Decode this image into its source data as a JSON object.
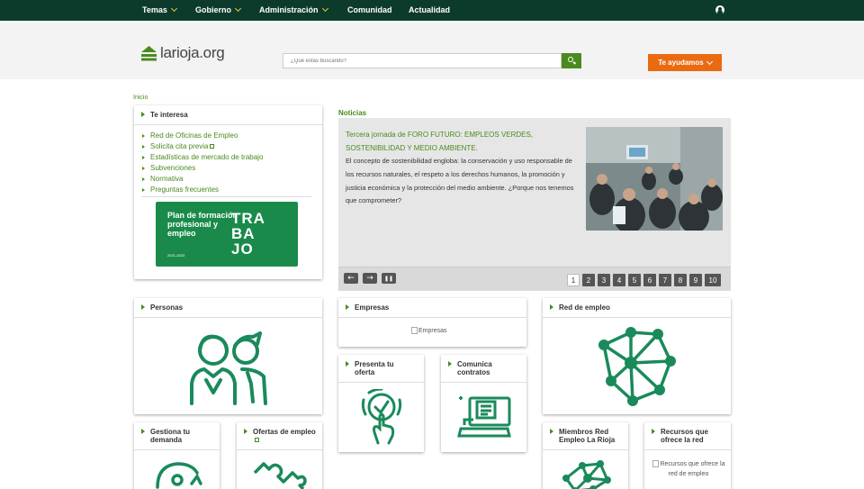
{
  "topnav": {
    "items": [
      {
        "label": "Temas",
        "dropdown": true
      },
      {
        "label": "Gobierno",
        "dropdown": true
      },
      {
        "label": "Administración",
        "dropdown": true
      },
      {
        "label": "Comunidad",
        "dropdown": false
      },
      {
        "label": "Actualidad",
        "dropdown": false
      }
    ]
  },
  "header": {
    "logo_text": "larioja.org",
    "search_placeholder": "¿Qué estás buscando?",
    "help_label": "Te ayudamos"
  },
  "breadcrumb": "Inicio",
  "interesa": {
    "title": "Te interesa",
    "links": [
      "Red de Oficinas de Empleo",
      "Solicita cita previa",
      "Estadísticas de mercado de trabajo",
      "Subvenciones",
      "Normativa",
      "Preguntas frecuentes"
    ],
    "banner_title": "Plan de formación profesional y empleo",
    "banner_years": "2021-2023",
    "banner_big": [
      "TRA",
      "BA",
      "JO"
    ]
  },
  "news": {
    "label": "Noticias",
    "title": "Tercera jornada de FORO FUTURO: EMPLEOS VERDES, SOSTENIBILIDAD Y MEDIO AMBIENTE.",
    "body": "El concepto de sostenibilidad engloba: la conservación y uso responsable de los recursos naturales, el respeto a los derechos humanos, la promoción y justicia económica y la protección del medio ambiente. ¿Porque nos tenemos que comprometer?",
    "pages": [
      "1",
      "2",
      "3",
      "4",
      "5",
      "6",
      "7",
      "8",
      "9",
      "10"
    ],
    "active_page": "1",
    "prev": "←",
    "next": "→",
    "pause": "❚❚"
  },
  "tiles": {
    "personas": "Personas",
    "empresas": "Empresas",
    "empresas_alt": "Empresas",
    "red_empleo": "Red de empleo",
    "presenta": "Presenta tu oferta",
    "comunica": "Comunica contratos",
    "gestiona": "Gestiona tu demanda",
    "ofertas": "Ofertas de empleo",
    "miembros": "Miembros Red Empleo La Rioja",
    "recursos": "Recursos que ofrece la red",
    "recursos_alt": "Recursos que ofrece la red de empleo"
  },
  "colors": {
    "nav": "#0d3b2b",
    "accent": "#4a8a1f",
    "help": "#ea6a12",
    "icon": "#1a8a5a"
  }
}
